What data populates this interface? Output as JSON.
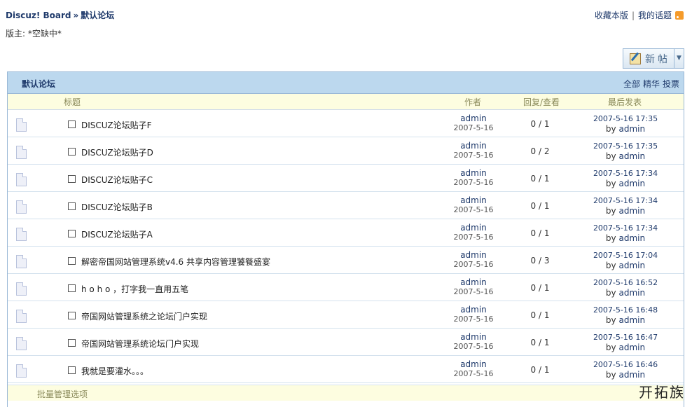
{
  "breadcrumb": {
    "home": "Discuz! Board",
    "separator": "»",
    "current": "默认论坛"
  },
  "moderator": "版主: *空缺中*",
  "toplinks": {
    "favorite": "收藏本版",
    "divider": "|",
    "my_topics": "我的话题"
  },
  "new_post_button": {
    "label": "新帖"
  },
  "board": {
    "title": "默认论坛",
    "filters": [
      "全部",
      "精华",
      "投票"
    ],
    "columns": {
      "subject": "标题",
      "author": "作者",
      "replies_views": "回复/查看",
      "last_post": "最后发表"
    },
    "threads": [
      {
        "subject": "DISCUZ论坛贴子F",
        "author": "admin",
        "date": "2007-5-16",
        "stats": "0 / 1",
        "last_time": "2007-5-16 17:35",
        "last_by_prefix": "by",
        "last_by": "admin"
      },
      {
        "subject": "DISCUZ论坛贴子D",
        "author": "admin",
        "date": "2007-5-16",
        "stats": "0 / 2",
        "last_time": "2007-5-16 17:35",
        "last_by_prefix": "by",
        "last_by": "admin"
      },
      {
        "subject": "DISCUZ论坛贴子C",
        "author": "admin",
        "date": "2007-5-16",
        "stats": "0 / 1",
        "last_time": "2007-5-16 17:34",
        "last_by_prefix": "by",
        "last_by": "admin"
      },
      {
        "subject": "DISCUZ论坛贴子B",
        "author": "admin",
        "date": "2007-5-16",
        "stats": "0 / 1",
        "last_time": "2007-5-16 17:34",
        "last_by_prefix": "by",
        "last_by": "admin"
      },
      {
        "subject": "DISCUZ论坛贴子A",
        "author": "admin",
        "date": "2007-5-16",
        "stats": "0 / 1",
        "last_time": "2007-5-16 17:34",
        "last_by_prefix": "by",
        "last_by": "admin"
      },
      {
        "subject": "解密帝国网站管理系统v4.6 共享内容管理饕餮盛宴",
        "author": "admin",
        "date": "2007-5-16",
        "stats": "0 / 3",
        "last_time": "2007-5-16 17:04",
        "last_by_prefix": "by",
        "last_by": "admin"
      },
      {
        "subject": "h o h o ，打字我一直用五笔",
        "author": "admin",
        "date": "2007-5-16",
        "stats": "0 / 1",
        "last_time": "2007-5-16 16:52",
        "last_by_prefix": "by",
        "last_by": "admin"
      },
      {
        "subject": "帝国网站管理系统之论坛门户实现",
        "author": "admin",
        "date": "2007-5-16",
        "stats": "0 / 1",
        "last_time": "2007-5-16 16:48",
        "last_by_prefix": "by",
        "last_by": "admin"
      },
      {
        "subject": "帝国网站管理系统论坛门户实现",
        "author": "admin",
        "date": "2007-5-16",
        "stats": "0 / 1",
        "last_time": "2007-5-16 16:47",
        "last_by_prefix": "by",
        "last_by": "admin"
      },
      {
        "subject": "我就是要灌水。。。",
        "author": "admin",
        "date": "2007-5-16",
        "stats": "0 / 1",
        "last_time": "2007-5-16 16:46",
        "last_by_prefix": "by",
        "last_by": "admin"
      }
    ],
    "batch_options": "批量管理选项"
  },
  "watermark": "开拓族"
}
